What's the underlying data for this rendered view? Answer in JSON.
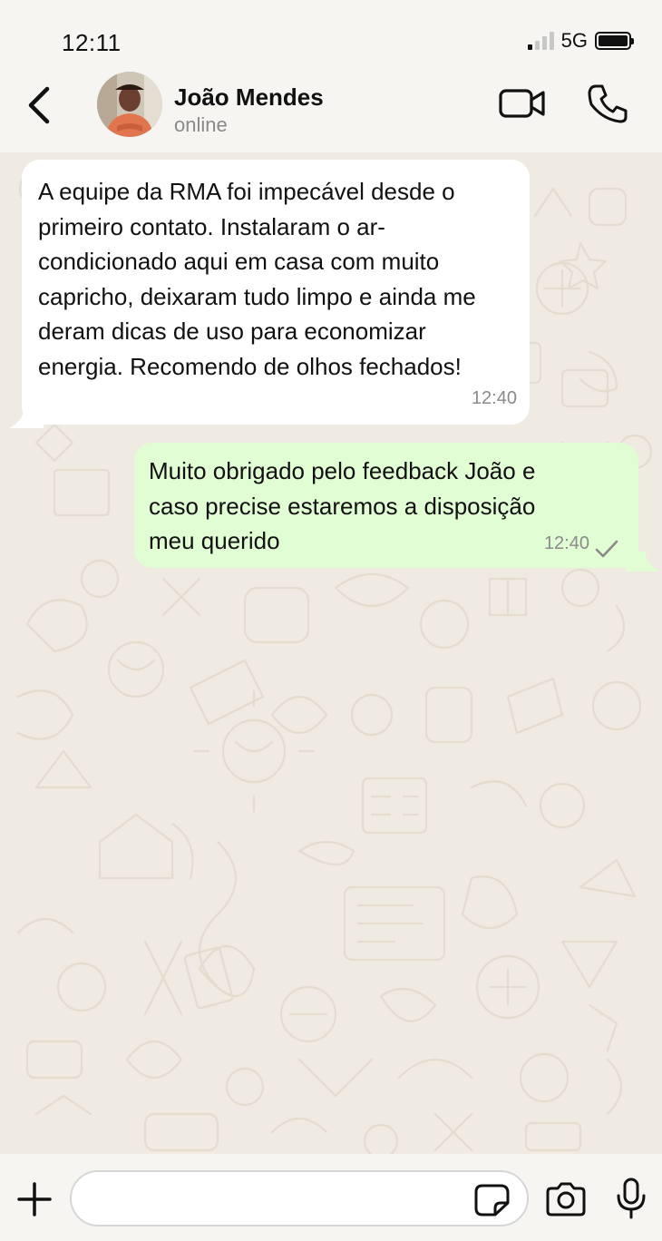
{
  "status_bar": {
    "time": "12:11",
    "network": "5G",
    "signal_bars_active": 1,
    "signal_bars_total": 4,
    "battery_level": 1.0
  },
  "header": {
    "back_icon": "chevron-left-icon",
    "contact_name": "João Mendes",
    "contact_status": "online",
    "video_icon": "video-camera-icon",
    "call_icon": "phone-icon"
  },
  "messages": [
    {
      "direction": "incoming",
      "text": "A equipe da RMA foi impecável desde o\nprimeiro contato. Instalaram o ar-\ncondicionado aqui em casa com muito\ncapricho, deixaram tudo limpo e ainda me\nderam dicas de uso para economizar\nenergia. Recomendo de olhos fechados!",
      "time": "12:40"
    },
    {
      "direction": "outgoing",
      "text": "Muito obrigado pelo feedback João e\ncaso precise estaremos a disposição\nmeu querido",
      "time": "12:40",
      "status_icon": "single-check-icon"
    }
  ],
  "input_bar": {
    "plus_icon": "plus-icon",
    "message_value": "",
    "sticker_icon": "sticker-icon",
    "camera_icon": "camera-icon",
    "mic_icon": "microphone-icon"
  },
  "colors": {
    "background": "#f6f5f2",
    "chat_background": "#efeae2",
    "incoming_bubble": "#ffffff",
    "outgoing_bubble": "#e1fdd4",
    "secondary_text": "#8a8a8a"
  }
}
